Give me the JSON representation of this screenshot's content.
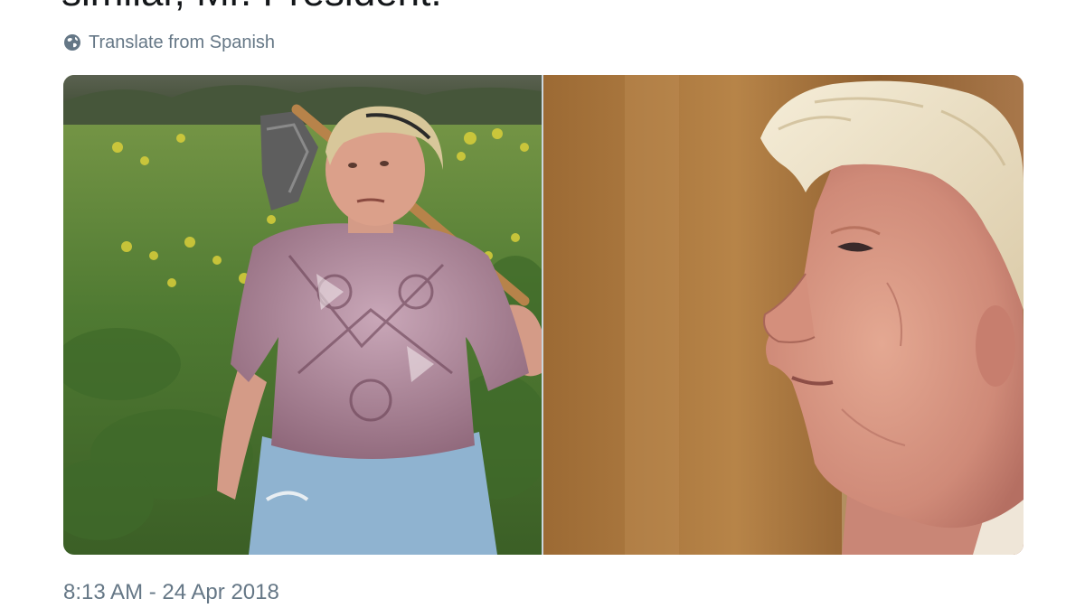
{
  "tweet": {
    "text_fragment": "similar, Mr. President.",
    "translate_label": "Translate from Spanish",
    "timestamp": "8:13 AM - 24 Apr 2018"
  },
  "icons": {
    "translate": "globe-icon"
  },
  "media": {
    "photos": [
      {
        "description_name": "woman-with-hoe-photo"
      },
      {
        "description_name": "man-profile-photo"
      }
    ]
  },
  "colors": {
    "text_primary": "#14171a",
    "text_secondary": "#657786"
  }
}
